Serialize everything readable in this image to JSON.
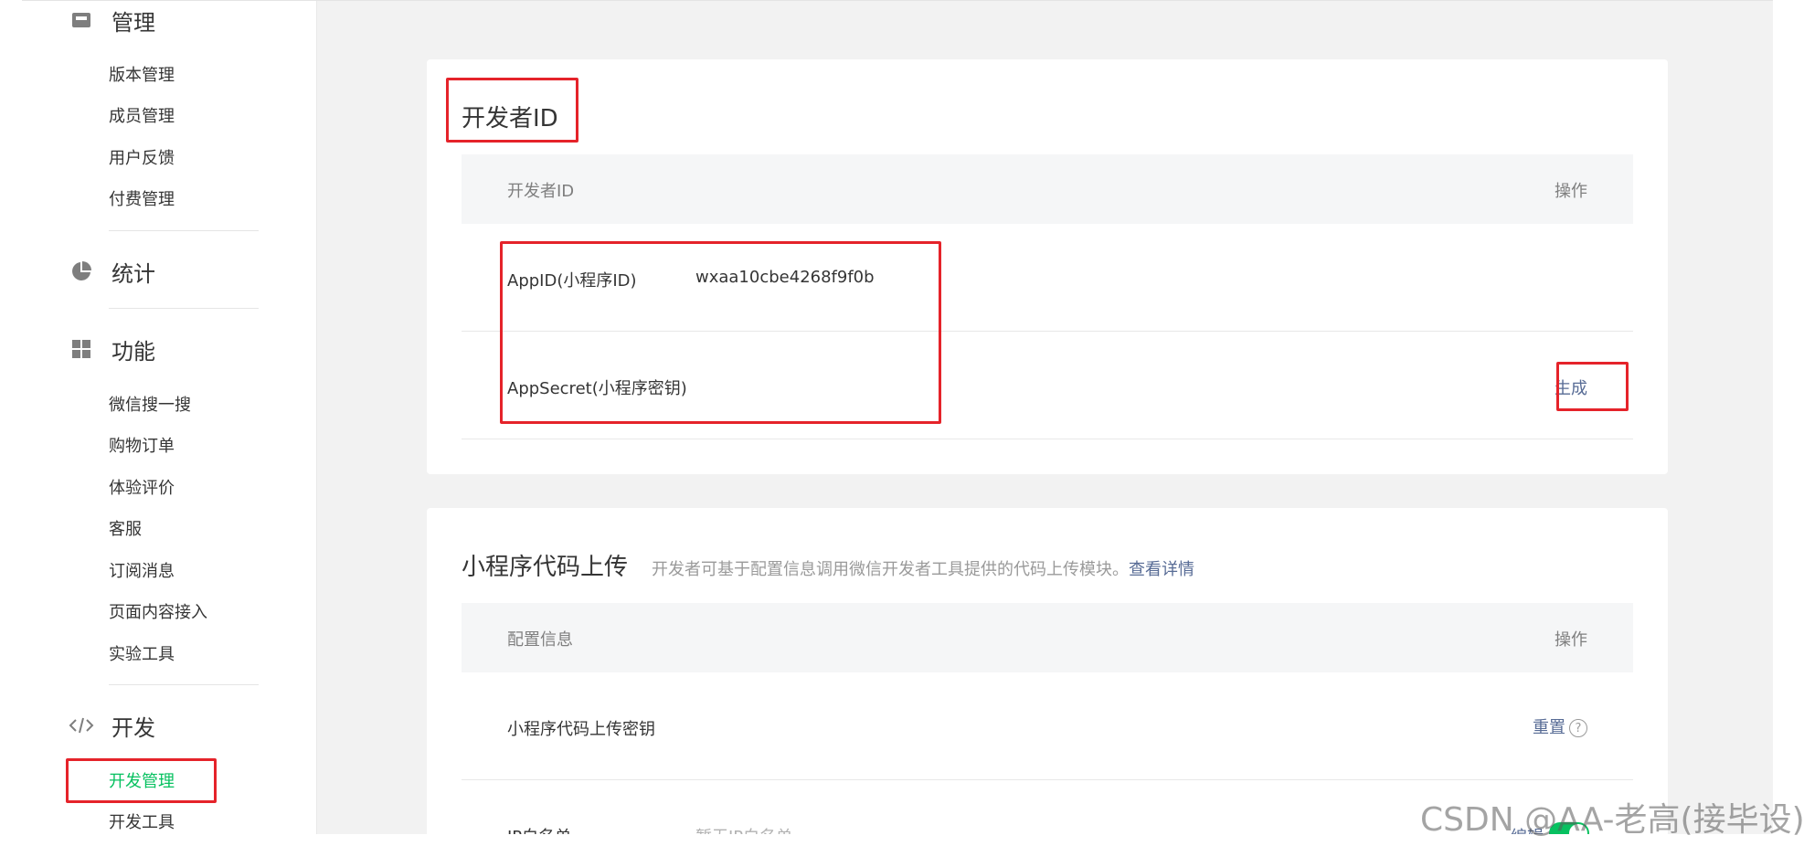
{
  "sidebar": {
    "sections": [
      {
        "title": "管理",
        "icon": "mailbox-icon"
      },
      {
        "title": "统计",
        "icon": "pie-chart-icon"
      },
      {
        "title": "功能",
        "icon": "grid-icon"
      },
      {
        "title": "开发",
        "icon": "code-icon"
      }
    ],
    "manage_items": [
      "版本管理",
      "成员管理",
      "用户反馈",
      "付费管理"
    ],
    "feature_items": [
      "微信搜一搜",
      "购物订单",
      "体验评价",
      "客服",
      "订阅消息",
      "页面内容接入",
      "实验工具"
    ],
    "dev_items": [
      {
        "label": "开发管理",
        "active": true
      },
      {
        "label": "开发工具",
        "active": false
      }
    ]
  },
  "developer_id_card": {
    "title": "开发者ID",
    "col_name": "开发者ID",
    "col_action": "操作",
    "rows": [
      {
        "label": "AppID(小程序ID)",
        "value": "wxaa10cbe4268f9f0b",
        "action": ""
      },
      {
        "label": "AppSecret(小程序密钥)",
        "value": "",
        "action": "生成"
      }
    ]
  },
  "upload_card": {
    "title": "小程序代码上传",
    "description": "开发者可基于配置信息调用微信开发者工具提供的代码上传模块。",
    "details_link": "查看详情",
    "col_name": "配置信息",
    "col_action": "操作",
    "rows": [
      {
        "label": "小程序代码上传密钥",
        "value": "",
        "action": "重置",
        "help": "?"
      },
      {
        "label": "IP白名单",
        "value": "暂无IP白名单",
        "action": "编辑"
      }
    ]
  },
  "watermark": "CSDN @AA-老高(接毕设)",
  "colors": {
    "accent_green": "#07c160",
    "link_blue": "#576b95",
    "highlight_red": "#e5232a"
  }
}
